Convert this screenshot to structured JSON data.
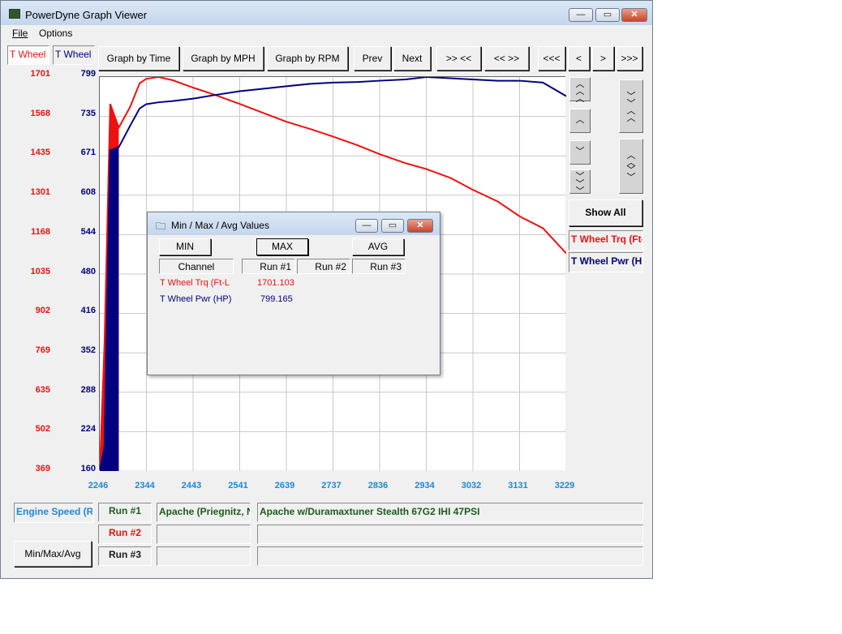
{
  "window": {
    "title": "PowerDyne Graph Viewer",
    "buttons": {
      "minimize": "—",
      "maximize": "▭",
      "close": "✕"
    }
  },
  "menu": {
    "file": "File",
    "options": "Options"
  },
  "tabs": {
    "left": "T Wheel",
    "right": "T Wheel"
  },
  "toolbar": {
    "graph_time": "Graph by Time",
    "graph_mph": "Graph by MPH",
    "graph_rpm": "Graph by RPM",
    "prev": "Prev",
    "next": "Next",
    "zoom_in": ">> <<",
    "zoom_out": "<< >>",
    "far_left": "<<<",
    "left": "<",
    "right": ">",
    "far_right": ">>>"
  },
  "y_axis_left": [
    "1701",
    "1568",
    "1435",
    "1301",
    "1168",
    "1035",
    "902",
    "769",
    "635",
    "502",
    "369"
  ],
  "y_axis_right": [
    "799",
    "735",
    "671",
    "608",
    "544",
    "480",
    "416",
    "352",
    "288",
    "224",
    "160"
  ],
  "x_axis": [
    "2246",
    "2344",
    "2443",
    "2541",
    "2639",
    "2737",
    "2836",
    "2934",
    "3032",
    "3131",
    "3229"
  ],
  "right_panel": {
    "show_all": "Show All",
    "channel1": "T Wheel Trq (Ft-",
    "channel2": "T Wheel Pwr (HP"
  },
  "bottom": {
    "x_channel": "Engine Speed (RI",
    "min_max_avg": "Min/Max/Avg",
    "run1": "Run #1",
    "run2": "Run #2",
    "run3": "Run #3",
    "run1_vehicle": "Apache (Priegnitz, N",
    "run1_desc": "Apache w/Duramaxtuner Stealth 67G2 IHI 47PSI",
    "run2_vehicle": "",
    "run2_desc": "",
    "run3_vehicle": "",
    "run3_desc": ""
  },
  "dialog": {
    "title": "Min / Max / Avg Values",
    "min": "MIN",
    "max": "MAX",
    "avg": "AVG",
    "col_channel": "Channel",
    "col_run1": "Run #1",
    "col_run2": "Run #2",
    "col_run3": "Run #3",
    "rows": [
      {
        "channel": "T Wheel Trq (Ft-L",
        "run1": "1701.103"
      },
      {
        "channel": "T Wheel Pwr (HP)",
        "run1": "799.165"
      }
    ]
  },
  "colors": {
    "torque": "#ee1111",
    "power": "#000080",
    "xaxis": "#1e88d8",
    "run_label": "#1a5c1a"
  },
  "chart_data": {
    "type": "line",
    "x_range": [
      2246,
      3229
    ],
    "y_left_range": [
      369,
      1701
    ],
    "y_right_range": [
      160,
      799
    ],
    "grid": true,
    "series": [
      {
        "name": "T Wheel Trq (Ft-",
        "axis": "left",
        "x": [
          2246,
          2256,
          2268,
          2286,
          2310,
          2330,
          2344,
          2370,
          2400,
          2443,
          2490,
          2541,
          2590,
          2639,
          2690,
          2737,
          2790,
          2836,
          2890,
          2934,
          2985,
          3032,
          3085,
          3131,
          3180,
          3229
        ],
        "y": [
          369,
          800,
          1610,
          1530,
          1600,
          1680,
          1695,
          1701,
          1690,
          1665,
          1640,
          1610,
          1580,
          1550,
          1525,
          1500,
          1470,
          1440,
          1410,
          1390,
          1360,
          1320,
          1280,
          1230,
          1190,
          1105
        ]
      },
      {
        "name": "T Wheel Pwr (HP",
        "axis": "right",
        "x": [
          2246,
          2256,
          2268,
          2286,
          2310,
          2330,
          2344,
          2370,
          2400,
          2443,
          2490,
          2541,
          2590,
          2639,
          2690,
          2737,
          2790,
          2836,
          2890,
          2934,
          2985,
          3032,
          3085,
          3131,
          3180,
          3229
        ],
        "y": [
          160,
          200,
          680,
          685,
          720,
          748,
          755,
          758,
          760,
          764,
          770,
          776,
          780,
          784,
          788,
          790,
          791,
          793,
          795,
          799,
          797,
          795,
          793,
          793,
          790,
          768
        ]
      }
    ]
  }
}
